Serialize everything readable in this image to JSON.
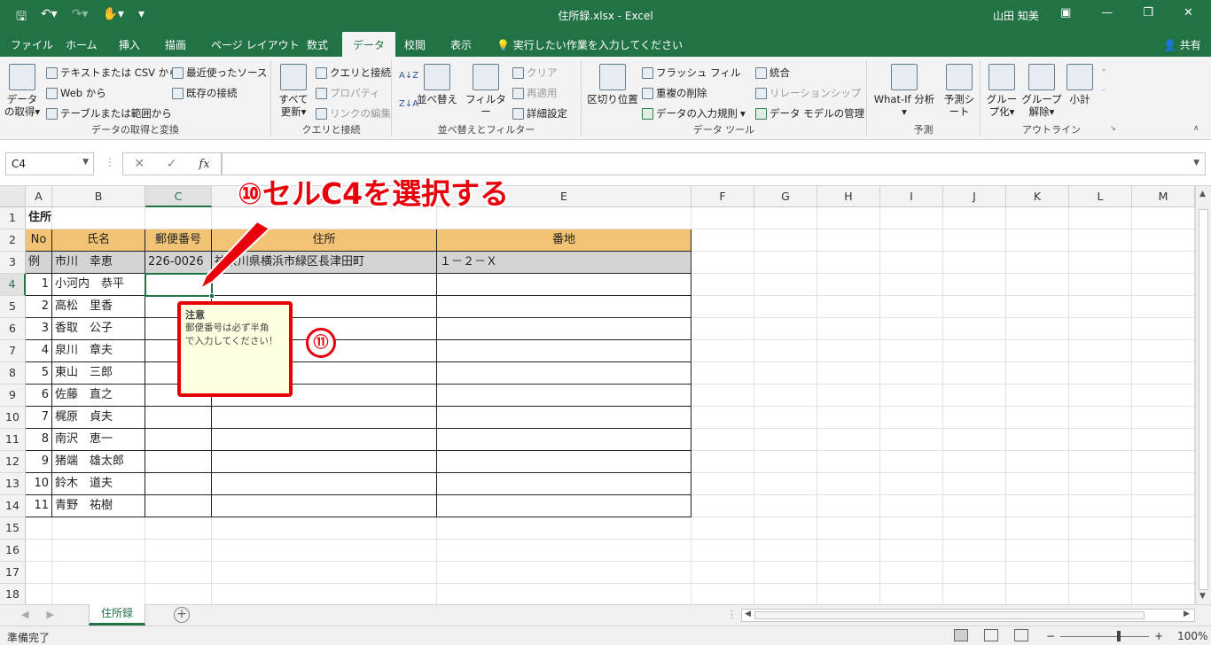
{
  "titlebar": {
    "title": "住所録.xlsx  -  Excel",
    "user": "山田 知美"
  },
  "menu": {
    "tabs": [
      "ファイル",
      "ホーム",
      "挿入",
      "描画",
      "ページ レイアウト",
      "数式",
      "データ",
      "校閲",
      "表示"
    ],
    "active_tab": "データ",
    "search": "実行したい作業を入力してください",
    "share": "共有"
  },
  "ribbon": {
    "get_data": {
      "label": "データの取得",
      "b1": "テキストまたは CSV から",
      "b2": "Web から",
      "b3": "テーブルまたは範囲から",
      "b4": "最近使ったソース",
      "b5": "既存の接続",
      "group": "データの取得と変換"
    },
    "queries": {
      "refresh": "すべて更新",
      "b1": "クエリと接続",
      "b2": "プロパティ",
      "b3": "リンクの編集",
      "group": "クエリと接続"
    },
    "sort": {
      "sort": "並べ替え",
      "filter": "フィルター",
      "clear": "クリア",
      "reapply": "再適用",
      "advanced": "詳細設定",
      "group": "並べ替えとフィルター"
    },
    "tools": {
      "split": "区切り位置",
      "flash": "フラッシュ フィル",
      "dup": "重複の削除",
      "validate": "データの入力規則",
      "consolidate": "統合",
      "relation": "リレーションシップ",
      "model": "データ モデルの管理",
      "group": "データ ツール"
    },
    "forecast": {
      "whatif": "What-If 分析",
      "sheet": "予測シート",
      "group": "予測"
    },
    "outline": {
      "group_btn": "グループ化",
      "ungroup": "グループ解除",
      "subtotal": "小計",
      "group": "アウトライン"
    }
  },
  "formula": {
    "namebox": "C4",
    "fx": "fx",
    "value": ""
  },
  "columns": [
    "A",
    "B",
    "C",
    "D",
    "E",
    "F",
    "G",
    "H",
    "I",
    "J",
    "K",
    "L",
    "M"
  ],
  "rows": [
    "1",
    "2",
    "3",
    "4",
    "5",
    "6",
    "7",
    "8",
    "9",
    "10",
    "11",
    "12",
    "13",
    "14",
    "15",
    "16",
    "17",
    "18"
  ],
  "sheet": {
    "title": "住所録",
    "headers": [
      "No",
      "氏名",
      "郵便番号",
      "住所",
      "番地"
    ],
    "example": [
      "例",
      "市川　幸恵",
      "226-0026",
      "神奈川県横浜市緑区長津田町",
      "１－２－Ｘ"
    ],
    "data": [
      [
        "1",
        "小河内　恭平"
      ],
      [
        "2",
        "高松　里香"
      ],
      [
        "3",
        "香取　公子"
      ],
      [
        "4",
        "泉川　章夫"
      ],
      [
        "5",
        "東山　三郎"
      ],
      [
        "6",
        "佐藤　直之"
      ],
      [
        "7",
        "梶原　貞夫"
      ],
      [
        "8",
        "南沢　恵一"
      ],
      [
        "9",
        "猪端　雄太郎"
      ],
      [
        "10",
        "鈴木　道夫"
      ],
      [
        "11",
        "青野　祐樹"
      ]
    ]
  },
  "tooltip": {
    "title": "注意",
    "line1": "郵便番号は必ず半角",
    "line2": "で入力してください！"
  },
  "annotations": {
    "callout": "⑩セルC4を選択する",
    "badge": "⑪"
  },
  "sheet_tab": "住所録",
  "status": {
    "ready": "準備完了",
    "zoom": "100%"
  },
  "colors": {
    "excel_green": "#217346",
    "header_fill": "#f2c275",
    "example_fill": "#d4d4d4",
    "annotation_red": "#e8000b"
  }
}
